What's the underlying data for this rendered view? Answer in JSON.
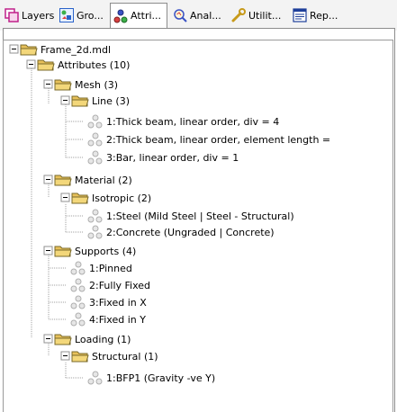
{
  "tabs": [
    {
      "label": "Layers",
      "icon": "layers-icon"
    },
    {
      "label": "Gro...",
      "icon": "groups-icon"
    },
    {
      "label": "Attri...",
      "icon": "attributes-icon",
      "active": true
    },
    {
      "label": "Anal...",
      "icon": "analysis-icon"
    },
    {
      "label": "Utilit...",
      "icon": "utilities-icon"
    },
    {
      "label": "Rep...",
      "icon": "reports-icon"
    }
  ],
  "tree": {
    "root": "Frame_2d.mdl",
    "attributes": "Attributes (10)",
    "mesh": "Mesh (3)",
    "line": "Line (3)",
    "line_items": [
      "1:Thick beam, linear order, div = 4",
      "2:Thick beam, linear order, element length =",
      "3:Bar, linear order, div = 1"
    ],
    "material": "Material (2)",
    "isotropic": "Isotropic (2)",
    "isotropic_items": [
      "1:Steel (Mild Steel | Steel - Structural)",
      "2:Concrete (Ungraded | Concrete)"
    ],
    "supports": "Supports (4)",
    "support_items": [
      "1:Pinned",
      "2:Fully Fixed",
      "3:Fixed in X",
      "4:Fixed in Y"
    ],
    "loading": "Loading (1)",
    "structural": "Structural (1)",
    "structural_items": [
      "1:BFP1 (Gravity -ve Y)"
    ]
  },
  "colors": {
    "folder": "#e7c05a",
    "folder_dark": "#7a6a2a",
    "attribute_icon": "#aeaeae",
    "tree_line": "#a0a0a0"
  }
}
